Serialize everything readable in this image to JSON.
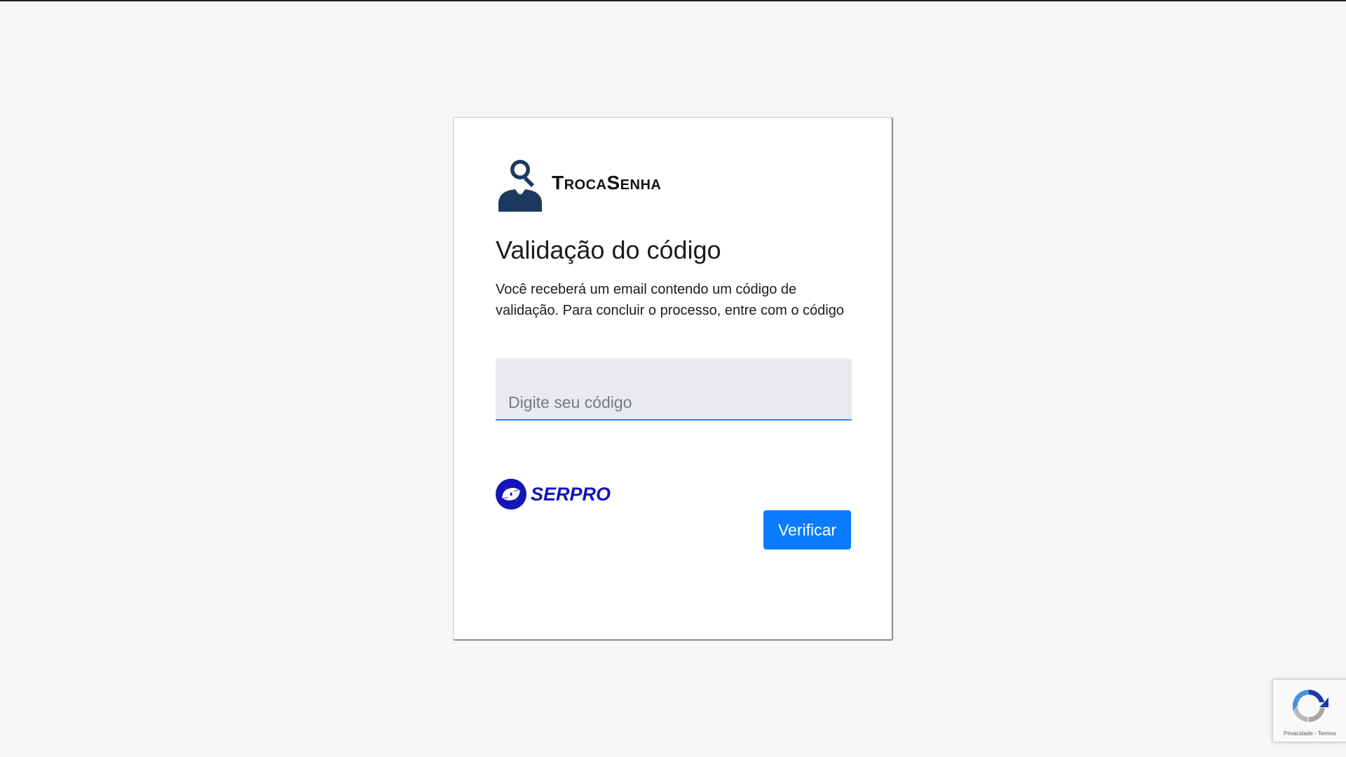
{
  "app": {
    "name": "TrocaSenha"
  },
  "form": {
    "title": "Validação do código",
    "description": "Você receberá um email contendo um código de validação. Para concluir o processo, entre com o código",
    "code_placeholder": "Digite seu código",
    "code_value": "",
    "submit_label": "Verificar"
  },
  "footer": {
    "logo_text": "SERPRO"
  },
  "recaptcha": {
    "privacy_label": "Privacidade",
    "separator": " - ",
    "terms_label": "Termos"
  },
  "colors": {
    "page_background": "#f6f6f6",
    "button": "#0a7bff",
    "input_background": "#e8eaed",
    "input_underline": "#3b82f6",
    "brand_icon": "#1c3a5e",
    "serpro_blue": "#1414b8"
  },
  "icons": {
    "brand": "person-with-magnifier-icon",
    "serpro": "serpro-swirl-icon",
    "recaptcha": "recaptcha-icon"
  }
}
